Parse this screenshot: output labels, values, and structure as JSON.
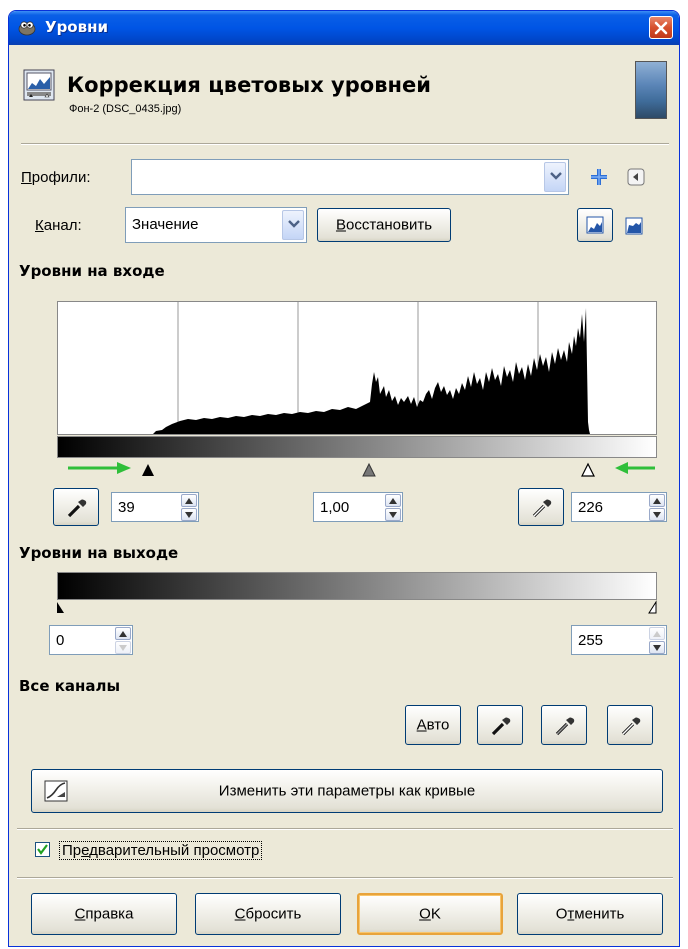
{
  "window": {
    "title": "Уровни",
    "close_icon": "close-icon"
  },
  "header": {
    "title": "Коррекция цветовых уровней",
    "subtitle": "Фон-2 (DSC_0435.jpg)"
  },
  "profiles": {
    "label_prefix": "П",
    "label_rest": "рофили:",
    "value": ""
  },
  "channel": {
    "label_prefix": "К",
    "label_rest": "анал:",
    "value": "Значение",
    "reset_prefix": "В",
    "reset_rest": "осстановить"
  },
  "input_levels": {
    "heading": "Уровни на входе",
    "low": "39",
    "gamma": "1,00",
    "high": "226"
  },
  "output_levels": {
    "heading": "Уровни на выходе",
    "low": "0",
    "high": "255"
  },
  "all_channels": {
    "heading": "Все каналы",
    "auto_prefix": "А",
    "auto_rest": "вто"
  },
  "curves_button": "Изменить эти параметры как кривые",
  "preview": {
    "prefix": "Пр",
    "mid": "е",
    "rest": "дварительный просмотр",
    "checked": true
  },
  "buttons": {
    "help_prefix": "С",
    "help_rest": "правка",
    "reset_prefix": "С",
    "reset_rest": "бросить",
    "ok_prefix": "O",
    "ok_rest": "K",
    "cancel_prefix": "О",
    "cancel_mid": "т",
    "cancel_rest": "менить"
  },
  "colors": {
    "titlebar": "#0055e5",
    "arrow_green": "#2fbf3a",
    "dialog_bg": "#ece9d8"
  }
}
